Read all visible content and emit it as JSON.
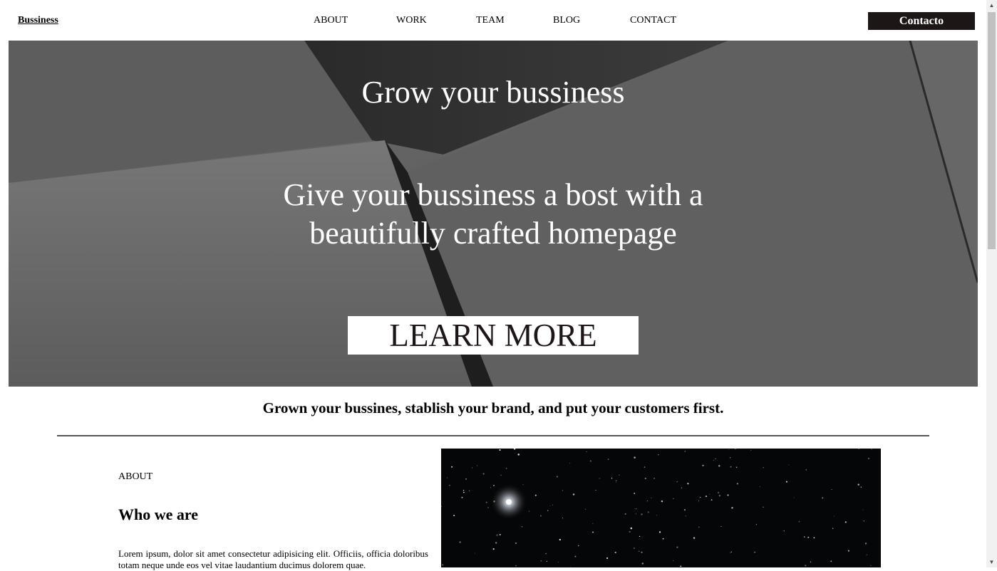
{
  "header": {
    "brand": "Bussiness",
    "nav": [
      "ABOUT",
      "WORK",
      "TEAM",
      "BLOG",
      "CONTACT"
    ],
    "contact_button": "Contacto"
  },
  "hero": {
    "title": "Grow your bussiness",
    "subtitle": "Give your bussiness a bost with a beautifully crafted homepage",
    "button": "LEARN MORE"
  },
  "tagline": "Grown your bussines, stablish your brand, and put your customers first.",
  "about": {
    "label": "ABOUT",
    "heading": "Who we are",
    "text": "Lorem ipsum, dolor sit amet consectetur adipisicing elit. Officiis, officia doloribus totam neque unde eos vel vitae laudantium ducimus dolorem quae."
  },
  "colors": {
    "contact_button_bg": "#1d1617",
    "hero_bg": "#5f5f5f",
    "divider": "#555555"
  }
}
